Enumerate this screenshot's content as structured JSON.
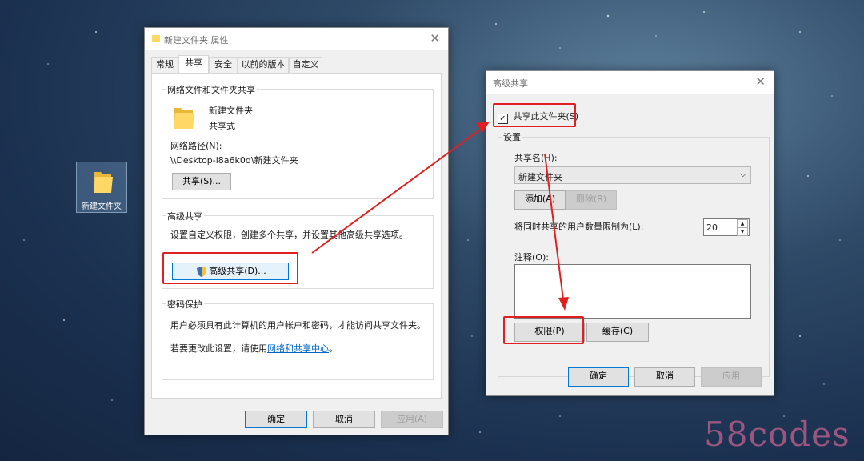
{
  "desktop": {
    "folder_label": "新建文件夹"
  },
  "props": {
    "title": "新建文件夹 属性",
    "tabs": [
      "常规",
      "共享",
      "安全",
      "以前的版本",
      "自定义"
    ],
    "net_group": "网络文件和文件夹共享",
    "folder_name": "新建文件夹",
    "share_state": "共享式",
    "path_label": "网络路径(N):",
    "path_value": "\\\\Desktop-i8a6k0d\\新建文件夹",
    "share_btn": "共享(S)...",
    "adv_group": "高级共享",
    "adv_desc": "设置自定义权限，创建多个共享，并设置其他高级共享选项。",
    "adv_btn": "高级共享(D)...",
    "pwd_group": "密码保护",
    "pwd_desc": "用户必须具有此计算机的用户帐户和密码，才能访问共享文件夹。",
    "pwd_link_prefix": "若要更改此设置，请使用",
    "pwd_link": "网络和共享中心",
    "pwd_link_suffix": "。",
    "ok": "确定",
    "cancel": "取消",
    "apply": "应用(A)"
  },
  "adv": {
    "title": "高级共享",
    "share_check": "共享此文件夹(S)",
    "settings": "设置",
    "share_name_label": "共享名(H):",
    "share_name": "新建文件夹",
    "add": "添加(A)",
    "remove": "删除(R)",
    "limit_label": "将同时共享的用户数量限制为(L):",
    "limit_value": "20",
    "comment_label": "注释(O):",
    "permissions": "权限(P)",
    "cache": "缓存(C)",
    "ok": "确定",
    "cancel": "取消",
    "apply": "应用"
  },
  "watermark": "58codes",
  "colors": {
    "accent": "#0078d7",
    "highlight": "#e02020",
    "link": "#0066cc"
  }
}
